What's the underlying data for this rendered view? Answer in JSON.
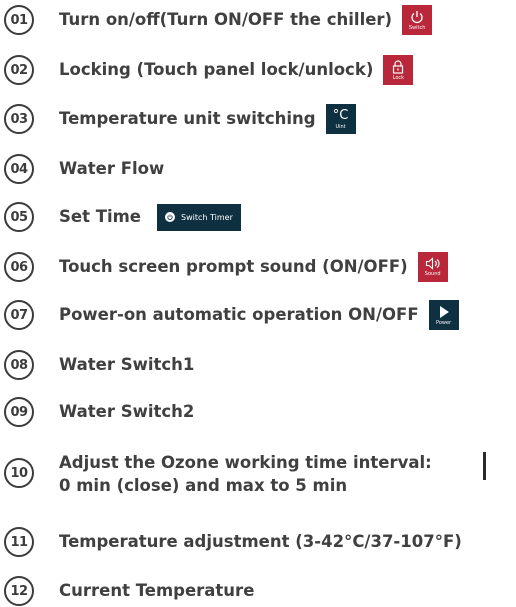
{
  "items": [
    {
      "num": "01",
      "label": "Turn on/off(Turn ON/OFF the chiller)",
      "icon": {
        "name": "power-icon",
        "caption": "Switch",
        "color": "#b8283a"
      }
    },
    {
      "num": "02",
      "label": "Locking (Touch panel lock/unlock)",
      "icon": {
        "name": "lock-icon",
        "caption": "Lock",
        "color": "#b8283a"
      }
    },
    {
      "num": "03",
      "label": "Temperature unit switching",
      "icon": {
        "name": "celsius-icon",
        "symbol": "°C",
        "caption": "Uint",
        "color": "#0e3040"
      }
    },
    {
      "num": "04",
      "label": "Water Flow"
    },
    {
      "num": "05",
      "label": "Set Time",
      "button": {
        "name": "switch-timer-button",
        "text": "Switch Timer",
        "color": "#0e3040"
      }
    },
    {
      "num": "06",
      "label": "Touch screen prompt sound (ON/OFF)",
      "icon": {
        "name": "sound-icon",
        "caption": "Sound",
        "color": "#b8283a"
      }
    },
    {
      "num": "07",
      "label": "Power-on automatic operation ON/OFF",
      "icon": {
        "name": "play-icon",
        "caption": "Power",
        "color": "#0e3040"
      }
    },
    {
      "num": "08",
      "label": "Water Switch1"
    },
    {
      "num": "09",
      "label": "Water Switch2"
    },
    {
      "num": "10",
      "label_line1": "Adjust the Ozone working time interval:",
      "label_line2": "0 min (close) and max to 5 min"
    },
    {
      "num": "11",
      "label": "Temperature adjustment (3-42°C/37-107°F)"
    },
    {
      "num": "12",
      "label": "Current Temperature"
    }
  ]
}
